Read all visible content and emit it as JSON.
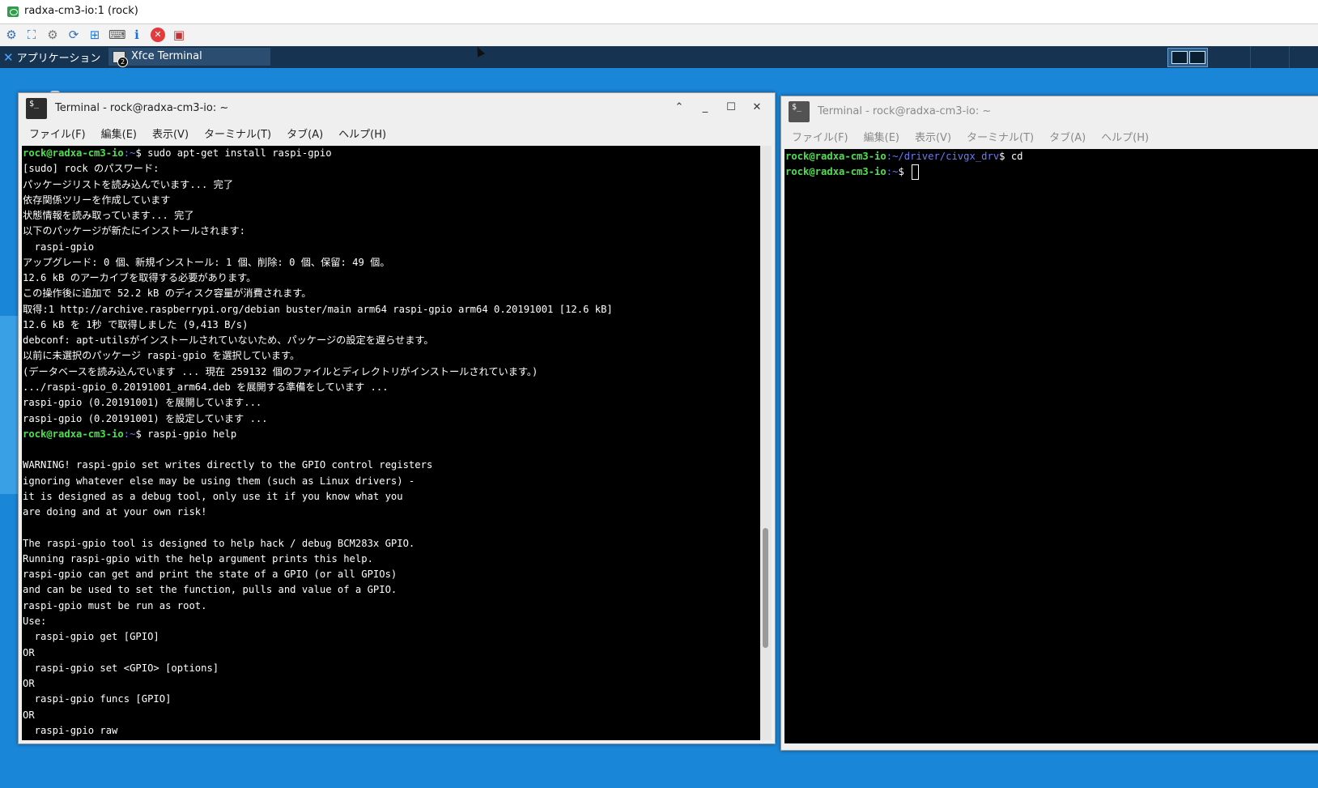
{
  "vnc": {
    "title": "radxa-cm3-io:1 (rock)",
    "toolbar": [
      {
        "name": "connection-options-icon",
        "glyph": "⚙"
      },
      {
        "name": "fullscreen-icon",
        "glyph": "⛶"
      },
      {
        "name": "settings-gear-icon",
        "glyph": "⚙"
      },
      {
        "name": "refresh-icon",
        "glyph": "⟳"
      },
      {
        "name": "windows-key-icon",
        "glyph": "⊞"
      },
      {
        "name": "ctrl-alt-del-icon",
        "glyph": "⌨"
      },
      {
        "name": "info-icon",
        "glyph": "ℹ"
      },
      {
        "name": "disconnect-icon",
        "glyph": "✕"
      },
      {
        "name": "file-transfer-icon",
        "glyph": "▣"
      }
    ]
  },
  "panel": {
    "apps_label": "アプリケーション",
    "task_label": "Xfce Terminal",
    "task_badge": "2"
  },
  "left_window": {
    "title": "Terminal - rock@radxa-cm3-io: ~",
    "menu": [
      "ファイル(F)",
      "編集(E)",
      "表示(V)",
      "ターミナル(T)",
      "タブ(A)",
      "ヘルプ(H)"
    ],
    "lines": [
      {
        "user": "rock@radxa-cm3-io",
        "path": ":~",
        "text": "$ sudo apt-get install raspi-gpio"
      },
      {
        "text": "[sudo] rock のパスワード:"
      },
      {
        "text": "パッケージリストを読み込んでいます... 完了"
      },
      {
        "text": "依存関係ツリーを作成しています"
      },
      {
        "text": "状態情報を読み取っています... 完了"
      },
      {
        "text": "以下のパッケージが新たにインストールされます:"
      },
      {
        "text": "  raspi-gpio"
      },
      {
        "text": "アップグレード: 0 個、新規インストール: 1 個、削除: 0 個、保留: 49 個。"
      },
      {
        "text": "12.6 kB のアーカイブを取得する必要があります。"
      },
      {
        "text": "この操作後に追加で 52.2 kB のディスク容量が消費されます。"
      },
      {
        "text": "取得:1 http://archive.raspberrypi.org/debian buster/main arm64 raspi-gpio arm64 0.20191001 [12.6 kB]"
      },
      {
        "text": "12.6 kB を 1秒 で取得しました (9,413 B/s)"
      },
      {
        "text": "debconf: apt-utilsがインストールされていないため、パッケージの設定を遅らせます。"
      },
      {
        "text": "以前に未選択のパッケージ raspi-gpio を選択しています。"
      },
      {
        "text": "(データベースを読み込んでいます ... 現在 259132 個のファイルとディレクトリがインストールされています。)"
      },
      {
        "text": ".../raspi-gpio_0.20191001_arm64.deb を展開する準備をしています ..."
      },
      {
        "text": "raspi-gpio (0.20191001) を展開しています..."
      },
      {
        "text": "raspi-gpio (0.20191001) を設定しています ..."
      },
      {
        "user": "rock@radxa-cm3-io",
        "path": ":~",
        "text": "$ raspi-gpio help"
      },
      {
        "text": ""
      },
      {
        "text": "WARNING! raspi-gpio set writes directly to the GPIO control registers"
      },
      {
        "text": "ignoring whatever else may be using them (such as Linux drivers) -"
      },
      {
        "text": "it is designed as a debug tool, only use it if you know what you"
      },
      {
        "text": "are doing and at your own risk!"
      },
      {
        "text": ""
      },
      {
        "text": "The raspi-gpio tool is designed to help hack / debug BCM283x GPIO."
      },
      {
        "text": "Running raspi-gpio with the help argument prints this help."
      },
      {
        "text": "raspi-gpio can get and print the state of a GPIO (or all GPIOs)"
      },
      {
        "text": "and can be used to set the function, pulls and value of a GPIO."
      },
      {
        "text": "raspi-gpio must be run as root."
      },
      {
        "text": "Use:"
      },
      {
        "text": "  raspi-gpio get [GPIO]"
      },
      {
        "text": "OR"
      },
      {
        "text": "  raspi-gpio set <GPIO> [options]"
      },
      {
        "text": "OR"
      },
      {
        "text": "  raspi-gpio funcs [GPIO]"
      },
      {
        "text": "OR"
      },
      {
        "text": "  raspi-gpio raw"
      }
    ]
  },
  "right_window": {
    "title": "Terminal - rock@radxa-cm3-io: ~",
    "menu": [
      "ファイル(F)",
      "編集(E)",
      "表示(V)",
      "ターミナル(T)",
      "タブ(A)",
      "ヘルプ(H)"
    ],
    "lines": [
      {
        "user": "rock@radxa-cm3-io",
        "path": ":~/driver/civgx_drv",
        "text": "$ cd"
      },
      {
        "user": "rock@radxa-cm3-io",
        "path": ":~",
        "text": "$ ",
        "cursor": true
      }
    ]
  }
}
